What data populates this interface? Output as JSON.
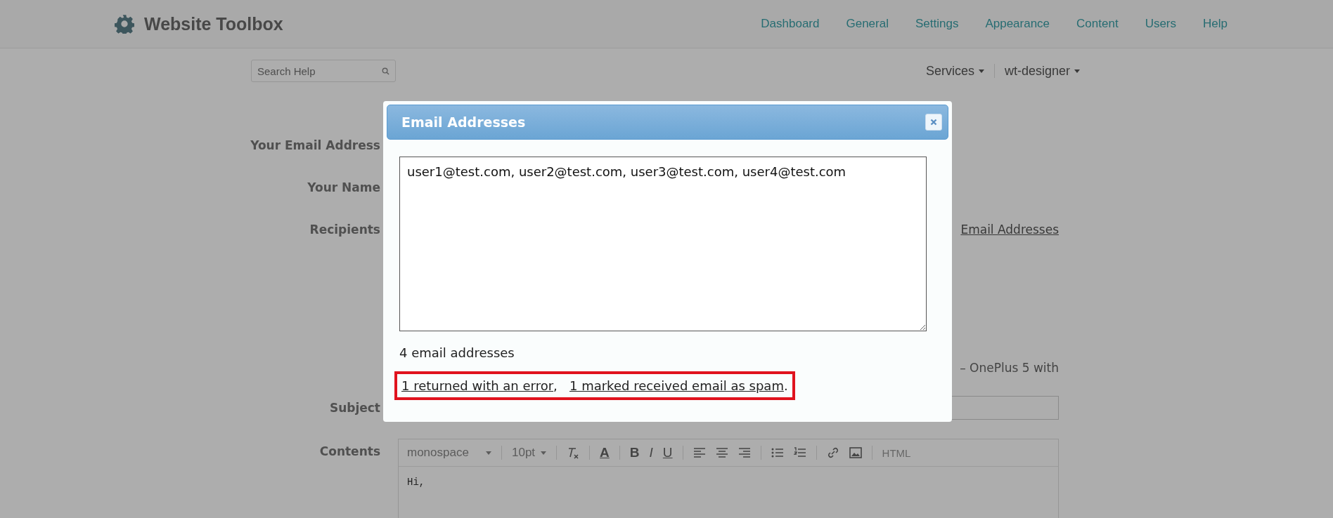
{
  "header": {
    "logo_text": "Website Toolbox",
    "nav": [
      "Dashboard",
      "General",
      "Settings",
      "Appearance",
      "Content",
      "Users",
      "Help"
    ]
  },
  "top_bar": {
    "search": {
      "placeholder": "Search Help"
    },
    "menus": [
      "Services",
      "wt-designer"
    ]
  },
  "form": {
    "labels": [
      "Your Email Address",
      "Your Name",
      "Recipients"
    ],
    "recipients_link": "Email Addresses",
    "note": "– OnePlus 5 with",
    "subject_label": "Subject",
    "contents_label": "Contents",
    "editor": {
      "font": "monospace",
      "size": "10pt",
      "text_buttons": [
        "B",
        "I",
        "U"
      ],
      "html_button": "HTML",
      "color_button": "A",
      "body": "Hi,"
    }
  },
  "modal": {
    "title": "Email Addresses",
    "value": "user1@test.com, user2@test.com, user3@test.com, user4@test.com",
    "count": "4 email addresses",
    "links": [
      "1 returned with an error",
      "1 marked received email as spam"
    ],
    "separator": ",",
    "end": ".",
    "highlighted": true
  }
}
